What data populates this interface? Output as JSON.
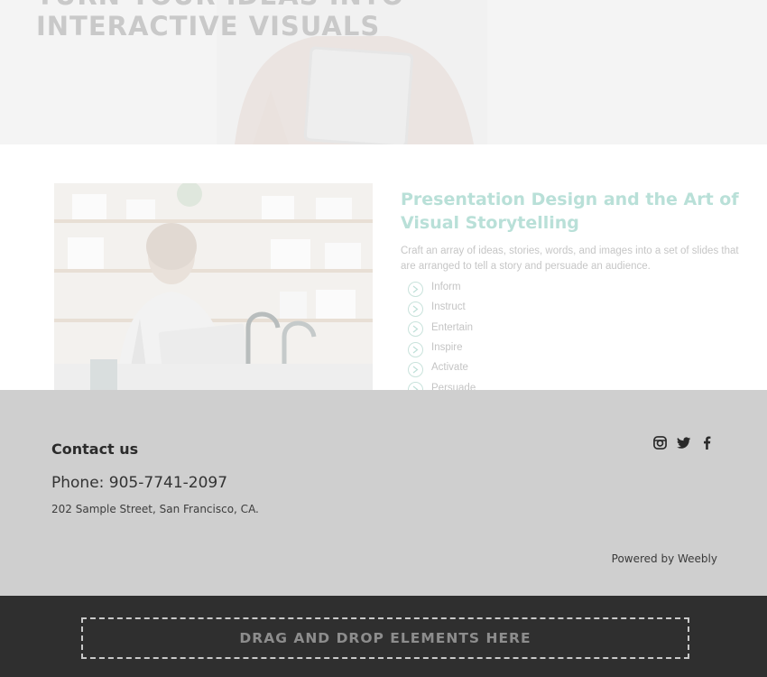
{
  "hero": {
    "title": "TURN YOUR IDEAS INTO\nINTERACTIVE VISUALS"
  },
  "feature": {
    "heading": "Presentation Design and the Art of Visual Storytelling",
    "description": "Craft an array of ideas, stories, words, and images into a set of slides that are arranged to tell a story and persuade an audience.",
    "items": [
      "Inform",
      "Instruct",
      "Entertain",
      "Inspire",
      "Activate",
      "Persuade"
    ]
  },
  "footer": {
    "contact_title": "Contact us",
    "phone": "Phone: 905-7741-2097",
    "address": "202 Sample Street, San Francisco, CA.",
    "powered_by": "Powered by Weebly",
    "social": [
      "instagram-icon",
      "twitter-icon",
      "facebook-icon"
    ]
  },
  "dropzone": {
    "label": "DRAG AND DROP ELEMENTS HERE"
  },
  "colors": {
    "accent": "#b9e0d8",
    "footer_bg": "#cfcfcf",
    "dropbar_bg": "#2f2f2f"
  }
}
